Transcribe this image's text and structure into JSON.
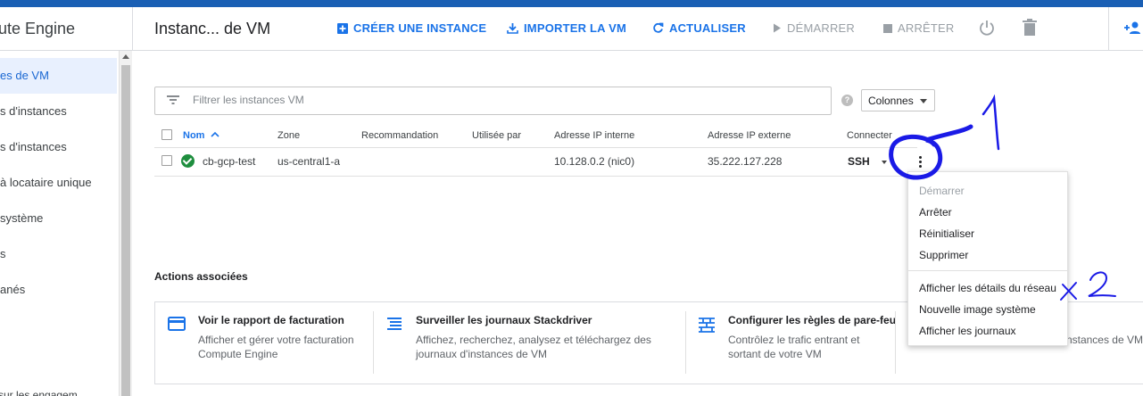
{
  "header": {
    "app_title": "ute Engine",
    "page_title": "Instanc... de VM",
    "toolbar": {
      "create": "CRÉER UNE INSTANCE",
      "import": "IMPORTER LA VM",
      "refresh": "ACTUALISER",
      "start": "DÉMARRER",
      "stop": "ARRÊTER"
    }
  },
  "sidebar": {
    "items": [
      {
        "label": "es de VM",
        "selected": true
      },
      {
        "label": "s d'instances"
      },
      {
        "label": "s d'instances"
      },
      {
        "label": "à locataire unique"
      },
      {
        "label": "système"
      },
      {
        "label": "s"
      },
      {
        "label": "anés"
      }
    ],
    "footer": "sur les engagem"
  },
  "filter": {
    "placeholder": "Filtrer les instances VM",
    "columns_button": "Colonnes"
  },
  "table": {
    "headers": {
      "name": "Nom",
      "zone": "Zone",
      "recommendation": "Recommandation",
      "used_by": "Utilisée par",
      "internal_ip": "Adresse IP interne",
      "external_ip": "Adresse IP externe",
      "connect": "Connecter"
    },
    "rows": [
      {
        "name": "cb-gcp-test",
        "zone": "us-central1-a",
        "internal_ip": "10.128.0.2 (nic0)",
        "external_ip": "35.222.127.228",
        "connect": "SSH",
        "status": "running"
      }
    ]
  },
  "context_menu": {
    "items": [
      {
        "label": "Démarrer",
        "disabled": true
      },
      {
        "label": "Arrêter"
      },
      {
        "label": "Réinitialiser"
      },
      {
        "label": "Supprimer"
      },
      {
        "label": "Afficher les détails du réseau"
      },
      {
        "label": "Nouvelle image système"
      },
      {
        "label": "Afficher les journaux"
      }
    ]
  },
  "related": {
    "title": "Actions associées",
    "cards": [
      {
        "title": "Voir le rapport de facturation",
        "desc": "Afficher et gérer votre facturation Compute Engine",
        "icon": "credit-card-icon"
      },
      {
        "title": "Surveiller les journaux Stackdriver",
        "desc": "Affichez, recherchez, analysez et téléchargez des journaux d'instances de VM",
        "icon": "logs-icon"
      },
      {
        "title": "Configurer les règles de pare-feu",
        "desc": "Contrôlez le trafic entrant et sortant de votre VM",
        "icon": "firewall-icon"
      },
      {
        "title": "",
        "desc": "ugmentation de quotas d'instances de VM",
        "icon": ""
      }
    ]
  },
  "annotations": {
    "label_1": "1",
    "label_2": "X 2"
  },
  "colors": {
    "accent": "#1a73e8",
    "top_bar": "#1a5fb4",
    "status_ok": "#1e8e3e",
    "annotation": "#1a1ae6"
  }
}
